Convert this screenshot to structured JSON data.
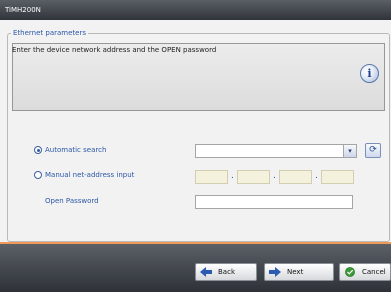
{
  "window": {
    "title": "TiMH200N"
  },
  "section": {
    "legend": "Ethernet parameters"
  },
  "info": {
    "text": "Enter the device network address and the OPEN password",
    "icon": "info-icon"
  },
  "form": {
    "automatic_search": {
      "label": "Automatic search",
      "selected": true,
      "value": ""
    },
    "manual_input": {
      "label": "Manual net-address input",
      "selected": false,
      "octets": [
        "",
        "",
        "",
        ""
      ],
      "dot": "."
    },
    "open_password": {
      "label": "Open Password",
      "value": ""
    }
  },
  "buttons": {
    "back": "Back",
    "next": "Next",
    "cancel": "Cancel"
  },
  "colors": {
    "accent": "#2c57a8",
    "separator": "#f19a58"
  }
}
